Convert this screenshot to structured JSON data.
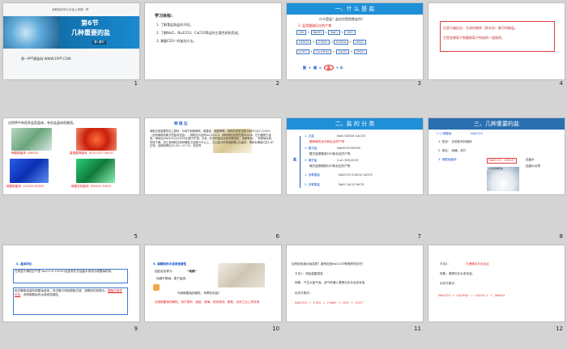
{
  "slides": [
    {
      "num": "1",
      "title_a": "第6节",
      "title_b": "几种重要的盐",
      "sub": "第1课时",
      "header_small": "浙教版科学九年级上册第一章",
      "footer": "第一PPT模板网-WWW.1PPT.COM"
    },
    {
      "num": "2",
      "heading": "学习目标：",
      "items": [
        "1. 了解食盐和盐的不同。",
        "2. 了解NaCl、Na2CO3、CaCO3等盐的主要性质和用途。",
        "3. 掌握CO3²⁻的鉴别方法。"
      ]
    },
    {
      "num": "3",
      "header": "一、什 么 是 盐",
      "q": "什么是盐？盐仅仅是指食盐吗？",
      "sub": "1. 盐是酸碱反应的产物",
      "rows": [
        [
          "HCl",
          "+",
          "NaOH",
          "=",
          "NaCl",
          "+",
          "H2O"
        ],
        [
          "H2SO4",
          "+",
          "2 KOH",
          "=",
          "K2SO4",
          "+",
          "2H2O"
        ],
        [
          "2 HCl",
          "+",
          "Ca (OH)2",
          "=",
          "CaCl2",
          "+",
          "2H2O"
        ]
      ],
      "bottom": [
        "酸",
        "+",
        "碱",
        "=",
        "盐",
        "+",
        "水"
      ]
    },
    {
      "num": "4",
      "text": [
        "凡是与碱反应、生成的物质（除水外）都可叫做盐。",
        "它是金属离子和酸根离子构成的一类物质。"
      ]
    },
    {
      "num": "5",
      "caption": "自然界中有很多盐是晶体，有些盐晶体很美丽。",
      "labels": [
        "硝酸钾晶体（KNO3）",
        "重铬酸钾晶体（K2Cr2O7·2H2O）",
        "硫酸铜晶体（CuSO4·5H2O）",
        "硫酸亚铁晶体（FeSO4·7H2O）"
      ]
    },
    {
      "num": "6",
      "title": "明 矾 石",
      "body": "明矾石是重要的化工原料，可用于制取明矾、硫酸铝、硫酸钾等。明矾的化学式是 KAl(SO4)2·12H2O（含有两种阳离子的盐叫复盐），明矾石中含有Al2(SO4)3、明矾等的化学式是K2SO4，它们都属于盐类。明矾石[KAl3(SO4)2(OH)6]属于矿物，白色（天然时因含杂质而带浅灰、浅黄等色），有玻璃光泽，性较干燥。浙江省明矾石探明储量占全国50%以上，尤以温州市苍南县明山为最多，明矾石储量约达1.67亿吨，含明矾钾达45.4%~47.7%，是世界"
    },
    {
      "num": "7",
      "header": "二、盐 的 分 类",
      "groups": [
        {
          "label": "1. 正盐",
          "formula": "NaCl   K2SO4  CaCO3",
          "desc": "酸和碱完全中和反应的产物"
        },
        {
          "label": "2. 酸式盐",
          "formula": "NaHCO3   KHSO4",
          "desc": "酸式盐是酸部分中和反应的产物"
        },
        {
          "label": "3. 碱式盐",
          "formula": "Cu2 (OH)2CO3",
          "desc": "碱式盐是碱部分中和反应的产物"
        }
      ],
      "more": [
        {
          "label": "1. 含氧酸盐",
          "formula": "Na2CO3  CuSO4  CaCO3"
        },
        {
          "label": "2. 无氧酸盐",
          "formula": "NaCl  CaCl2  FeCl3"
        }
      ],
      "side": "盐"
    },
    {
      "num": "8",
      "header": "三、几种重要的盐",
      "sub": "(一) 碳酸钠",
      "formula": "Na2CO3",
      "items": [
        "1. 性状：  白色粉末状固体",
        "2. 俗名：  纯碱、苏打",
        "3. 碳酸钠晶体："
      ],
      "crystal": "Na2CO3 · 10H2O",
      "right": [
        "结晶水",
        "结晶水合物"
      ],
      "pic": "白色固体粉末"
    },
    {
      "num": "9",
      "heading": "4. 晶体风化",
      "text": "在常温干燥的空气里 Na2CO3·10H2O会逐渐失去结晶水而成为碳酸钠粉末。",
      "bottom": "用试管取适量的碳酸钠溶液，向试管中滴加酚酞试液，观察到的现象为：",
      "red": "酚酞试液变红色",
      "end": "说明碳酸钠的水溶液显碱性。"
    },
    {
      "num": "10",
      "heading": "5. 碳酸钠的水溶液呈碱性",
      "line1": "因此俗名称为",
      "q1": "“纯碱”",
      "line2": "纯碱不是碱，属于盐类。",
      "q2": "利用碳酸钠的碱性，有哪些用途？",
      "ans": "利用碳酸钠的碱性，用于原料：造纸、玻璃、制洗涤剂、肥皂、纺织工业上的洗净"
    },
    {
      "num": "11",
      "q": "如何检验某化钠变质？鉴别检验Na2CO3等物质的存在？",
      "m1": "方法1：滴加盐酸溶液",
      "m2": "现象：产生大量气泡、该气体通入澄清石灰水后变浑浊",
      "eq": "化学方程式：",
      "eq_line": "Na2CO3  +  2 HCl  =  2 NaCl  +  H2O  +  CO2↑"
    },
    {
      "num": "12",
      "m": "方法2：",
      "m_text": "与澄清石灰水反应",
      "obs": "现象：澄清石灰水变浑浊。",
      "eq": "化学方程式：",
      "eq_line": "Na2CO3  +  Ca(OH)2  =  CaCO3 ↓  +  2NaOH"
    }
  ]
}
